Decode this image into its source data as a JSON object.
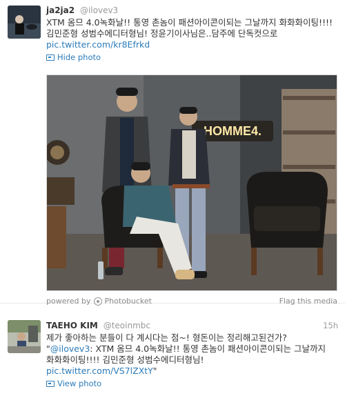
{
  "tweets": [
    {
      "name": "ja2ja2",
      "handle": "@ilovev3",
      "text": "XTM 옴므 4.0녹화날!! 통영 촌놈이 패션아이콘이되는 그날까지 화화화이팅!!!! 김민준형 성범수에디터형님! 정윤기이사님은..담주에 단독컷으로 ",
      "link": "pic.twitter.com/kr8Efrkd",
      "action": "Hide photo",
      "photo": {
        "sign_text": "HOMME4.",
        "powered_by": "powered by",
        "provider": "Photobucket",
        "flag": "Flag this media"
      }
    },
    {
      "name": "TAEHO KIM",
      "handle": "@teoinmbc",
      "time": "15h",
      "text": "제가 좋아하는 분들이 다 계시다는 점~! 형돈이는 정리해고된건가?",
      "quote_open": "\"",
      "quote_handle": "@ilovev3",
      "quote_text": ": XTM 옴므 4.0녹화날!! 통영 촌놈이 패션아이콘이되는 그날까지 화화화이팅!!!! 김민준형 성범수에디터형님!",
      "link": "pic.twitter.com/VS7lZXtY",
      "quote_close": "\"",
      "action": "View photo"
    }
  ],
  "colors": {
    "link": "#2b7bb9",
    "muted": "#999999",
    "text": "#333333"
  },
  "icons": [
    "photo-icon",
    "photobucket-logo-icon"
  ]
}
